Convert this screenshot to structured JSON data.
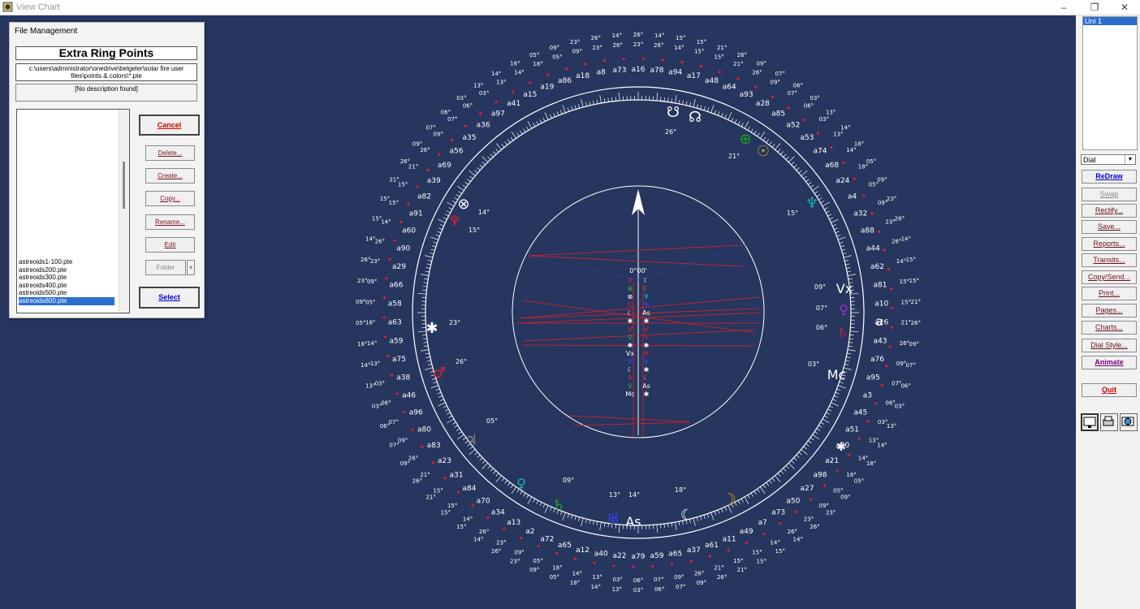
{
  "window": {
    "title": "View Chart",
    "controls": [
      "–",
      "❐",
      "✕"
    ]
  },
  "dialog": {
    "title": "File Management",
    "heading": "Extra Ring Points",
    "path_line1": "c:\\users\\administrator\\onedrive\\belgeler\\solar fire user",
    "path_line2": "files\\points & colors\\*.pte",
    "description": "[No description found]",
    "files": [
      "astreoids1-100.pte",
      "astreoids200.pte",
      "astreoids300.pte",
      "astreoids400.pte",
      "astreoids500.pte",
      "astreoids600.pte"
    ],
    "selected_file": "astreoids600.pte",
    "buttons": {
      "cancel": "Cancel",
      "delete": "Delete...",
      "create": "Create...",
      "copy": "Copy...",
      "rename": "Rename...",
      "edit": "Edit",
      "folder": "Folder",
      "select": "Select"
    }
  },
  "sidebar": {
    "list_item": "Uni 1",
    "dial_select": "Dial",
    "buttons": {
      "redraw": "ReDraw",
      "swap": "Swap",
      "rectify": "Rectify...",
      "save": "Save...",
      "reports": "Reports...",
      "transits": "Transits...",
      "copy_send": "Copy/Send...",
      "print": "Print...",
      "pages": "Pages...",
      "charts": "Charts...",
      "dial_style": "Dial Style...",
      "animate": "Animate",
      "quit": "Quit"
    }
  },
  "chart": {
    "center_degree": "0°00'",
    "angle_labels": {
      "ascendant": "As",
      "midheaven": "Mc",
      "vertex": "Vx",
      "aries_point": "a"
    },
    "asteroid_labels": [
      "a16",
      "a78",
      "a94",
      "a17",
      "a48",
      "a64",
      "a93",
      "a28",
      "a85",
      "a52",
      "a53",
      "a74",
      "a68",
      "a24",
      "a4",
      "a32",
      "a88",
      "a44",
      "a62",
      "a81",
      "a10",
      "a26",
      "a43",
      "a76",
      "a95",
      "a3",
      "a45",
      "a51",
      "a20",
      "a21",
      "a98",
      "a27",
      "a50",
      "a73",
      "a7",
      "a49",
      "a11",
      "a61",
      "a37",
      "a65",
      "a59",
      "a79",
      "a22",
      "a40",
      "a12",
      "a65",
      "a72",
      "a2",
      "a13",
      "a34",
      "a70",
      "a84",
      "a31",
      "a23",
      "a83",
      "a80",
      "a96",
      "a46",
      "a38",
      "a75",
      "a59",
      "a63",
      "a58",
      "a66",
      "a29",
      "a90",
      "a60",
      "a91",
      "a82",
      "a39",
      "a69",
      "a56",
      "a35",
      "a36",
      "a97",
      "a41",
      "a15",
      "a19",
      "a86",
      "a18",
      "a8",
      "a73"
    ],
    "planet_degrees": [
      "23°",
      "26°",
      "14°",
      "15°",
      "15°",
      "21°",
      "26°",
      "09°",
      "07°",
      "06°",
      "03°",
      "13°",
      "14°",
      "18°",
      "05°",
      "09°"
    ],
    "colors": {
      "background": "#26365e",
      "ring": "#ffffff",
      "midpoint_lines": "#e0202a",
      "asteroid_marks": "#e0202a"
    }
  }
}
